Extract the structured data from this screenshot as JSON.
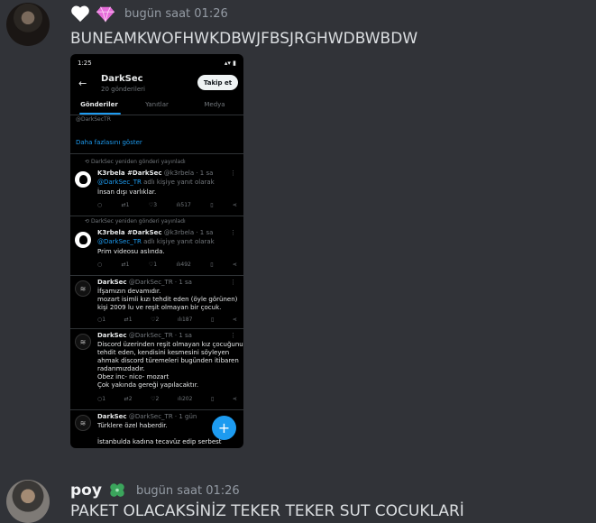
{
  "messages": [
    {
      "username": "",
      "timestamp": "bugün saat 01:26",
      "content": "BUNEAMKWOFHWKDBWJFBSJRGHWDBWBDW",
      "badges": [
        "heart-icon",
        "gem-icon"
      ]
    },
    {
      "username": "poy",
      "timestamp": "bugün saat 01:26",
      "content": "PAKET OLACAKSİNİZ TEKER TEKER SUT COCUKLARİ",
      "badges": [
        "clover-icon"
      ]
    }
  ],
  "phone": {
    "status_time": "1:25",
    "status_right": "▴▾ ▮",
    "back_icon": "back-arrow-icon",
    "profile_name": "DarkSec",
    "post_count": "20 gönderileri",
    "follow_label": "Takip et",
    "tabs": [
      "Gönderiler",
      "Yanıtlar",
      "Medya"
    ],
    "handle_fragment": "@DarkSecTR",
    "show_more": "Daha fazlasını göster",
    "tweets": [
      {
        "repost": "DarkSec yeniden gönderi yayınladı",
        "name": "K3rbela #DarkSec",
        "handle": "@k3rbela · 1 sa",
        "reply_to": "@DarkSec_TR",
        "reply_suffix": " adlı kişiye yanıt olarak",
        "lines": [
          "İnsan dışı varlıklar."
        ],
        "stats": [
          "",
          "1",
          "3",
          "517"
        ]
      },
      {
        "repost": "DarkSec yeniden gönderi yayınladı",
        "name": "K3rbela #DarkSec",
        "handle": "@k3rbela · 1 sa",
        "reply_to": "@DarkSec_TR",
        "reply_suffix": " adlı kişiye yanıt olarak",
        "lines": [
          "Prim videosu aslında."
        ],
        "stats": [
          "",
          "1",
          "1",
          "492"
        ]
      },
      {
        "repost": "",
        "name": "DarkSec",
        "handle": "@DarkSec_TR · 1 sa",
        "reply_to": "",
        "reply_suffix": "",
        "lines": [
          "İfşamızın devamıdır.",
          "mozart isimli kızı tehdit eden (öyle görünen)",
          "kişi 2009 lu ve reşit olmayan bir çocuk."
        ],
        "stats": [
          "1",
          "1",
          "2",
          "187"
        ]
      },
      {
        "repost": "",
        "name": "DarkSec",
        "handle": "@DarkSec_TR · 1 sa",
        "reply_to": "",
        "reply_suffix": "",
        "lines": [
          "Discord üzerinden reşit olmayan kız çocuğunu",
          "tehdit eden, kendisini kesmesini söyleyen",
          "ahmak discord türemeleri bugünden itibaren",
          "radarımızdadır.",
          "Obez inc- nico- mozart",
          "Çok yakında gereği yapılacaktır."
        ],
        "stats": [
          "1",
          "2",
          "2",
          "202"
        ]
      },
      {
        "repost": "",
        "name": "DarkSec",
        "handle": "@DarkSec_TR · 1 gün",
        "reply_to": "",
        "reply_suffix": "",
        "lines": [
          "Türklere özel haberdir.",
          "",
          "İstanbulda kadına tecavüz edip serbest"
        ],
        "stats": []
      }
    ],
    "fab_icon": "plus-icon"
  }
}
